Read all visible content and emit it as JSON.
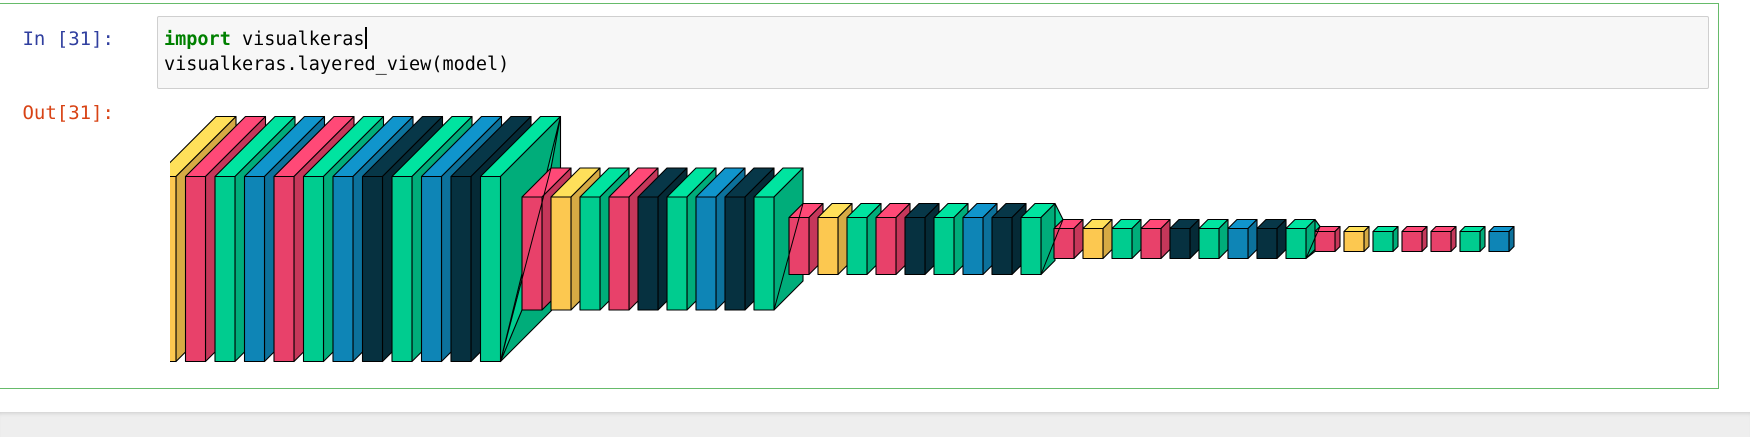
{
  "input_prompt": "In [31]:",
  "output_prompt": "Out[31]:",
  "code": {
    "line1_keyword": "import",
    "line1_rest": " visualkeras",
    "line2": "visualkeras.layered_view(model)"
  },
  "colors": {
    "yellow": "#fcc850",
    "red": "#e8416a",
    "green": "#00cc8f",
    "blue": "#0e85b6",
    "navy": "#063140"
  },
  "model_stages": [
    {
      "layers": [
        "yellow",
        "red",
        "green",
        "blue",
        "red",
        "green",
        "blue",
        "navy",
        "green",
        "blue",
        "navy",
        "green"
      ]
    },
    {
      "layers": [
        "red",
        "yellow",
        "green",
        "red",
        "navy",
        "green",
        "blue",
        "navy",
        "green"
      ]
    },
    {
      "layers": [
        "red",
        "yellow",
        "green",
        "red",
        "navy",
        "green",
        "blue",
        "navy",
        "green"
      ]
    },
    {
      "layers": [
        "red",
        "yellow",
        "green",
        "red",
        "navy",
        "green",
        "blue",
        "navy",
        "green"
      ]
    },
    {
      "layers": [
        "red",
        "yellow",
        "green",
        "red",
        "red",
        "green",
        "blue"
      ]
    }
  ]
}
